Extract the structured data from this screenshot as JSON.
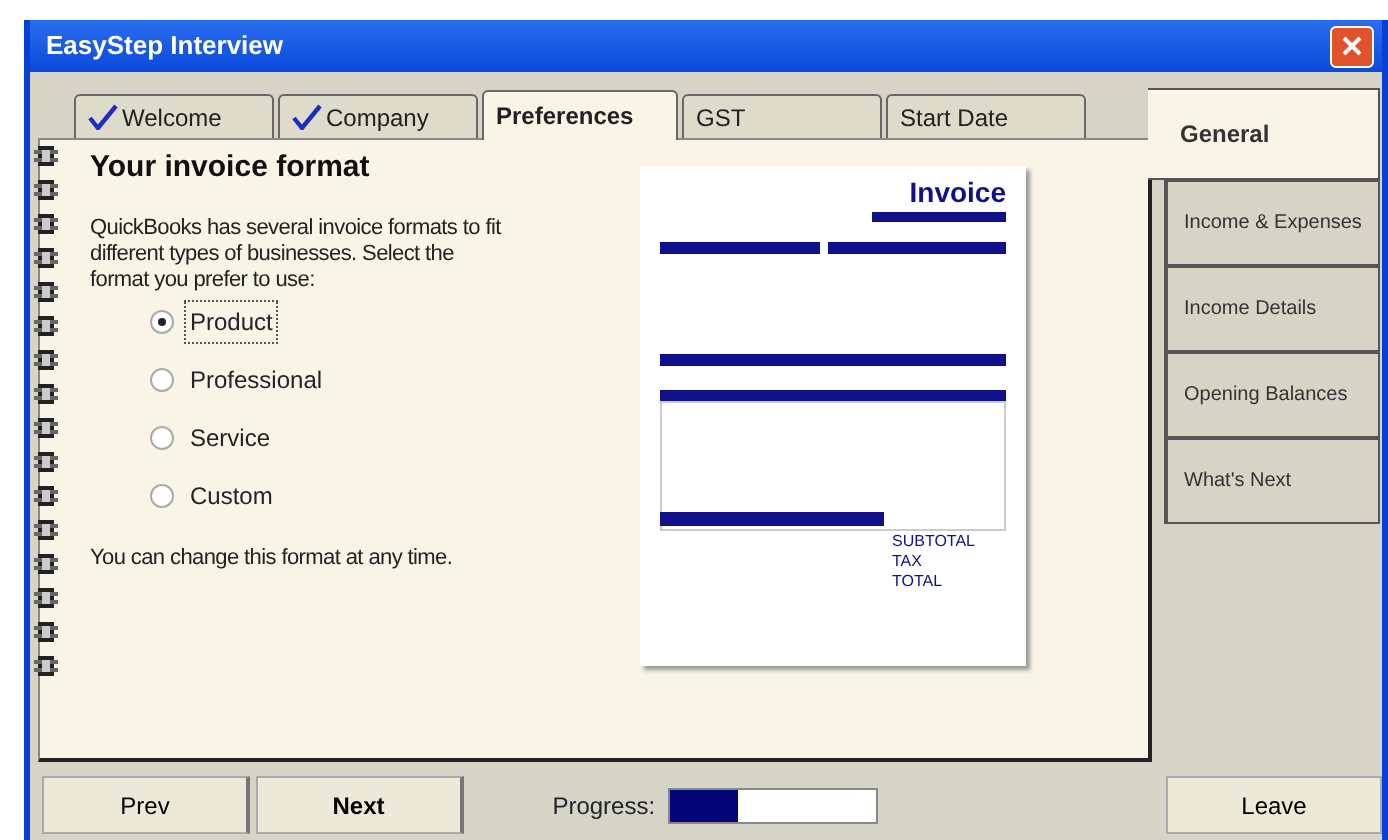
{
  "window": {
    "title": "EasyStep Interview"
  },
  "top_tabs": [
    {
      "label": "Welcome",
      "done": true,
      "selected": false
    },
    {
      "label": "Company",
      "done": true,
      "selected": false
    },
    {
      "label": "Preferences",
      "done": false,
      "selected": true
    },
    {
      "label": "GST",
      "done": false,
      "selected": false
    },
    {
      "label": "Start Date",
      "done": false,
      "selected": false
    }
  ],
  "side_tabs": [
    {
      "label": "General",
      "selected": true
    },
    {
      "label": "Income & Expenses",
      "selected": false
    },
    {
      "label": "Income Details",
      "selected": false
    },
    {
      "label": "Opening Balances",
      "selected": false
    },
    {
      "label": "What's Next",
      "selected": false
    }
  ],
  "page": {
    "heading": "Your invoice format",
    "intro": "QuickBooks has several invoice formats to fit different types of businesses.  Select the format you prefer to use:",
    "options": [
      {
        "label": "Product",
        "selected": true
      },
      {
        "label": "Professional",
        "selected": false
      },
      {
        "label": "Service",
        "selected": false
      },
      {
        "label": "Custom",
        "selected": false
      }
    ],
    "note": "You can change this format at any time."
  },
  "invoice_preview": {
    "title": "Invoice",
    "totals": [
      "SUBTOTAL",
      "TAX",
      "TOTAL"
    ]
  },
  "footer": {
    "prev": "Prev",
    "next": "Next",
    "progress_label": "Progress:",
    "progress": {
      "level": 0.33
    },
    "leave": "Leave"
  }
}
